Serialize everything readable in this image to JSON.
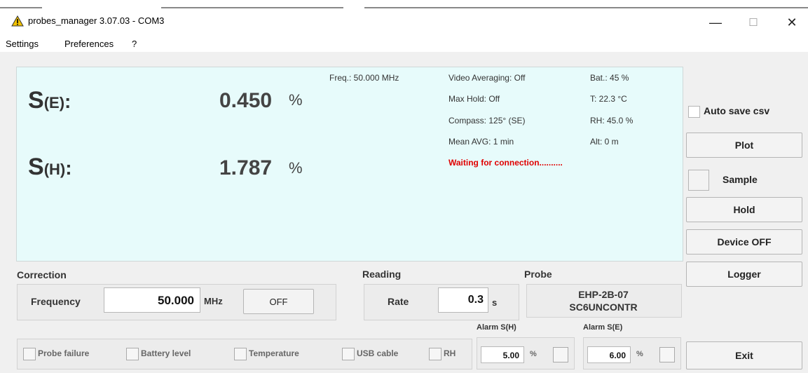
{
  "window": {
    "title": "probes_manager 3.07.03 - COM3",
    "minimize_glyph": "—",
    "maximize_glyph": "☐",
    "close_glyph": "✕"
  },
  "menu": {
    "items": [
      "Settings",
      "Preferences",
      "?"
    ]
  },
  "display": {
    "se_label": "S",
    "se_sub": "(E)",
    "se_colon": ":",
    "se_value": "0.450",
    "se_unit": "%",
    "sh_label": "S",
    "sh_sub": "(H)",
    "sh_colon": ":",
    "sh_value": "1.787",
    "sh_unit": "%",
    "freq": "Freq.: 50.000 MHz",
    "video_avg": "Video Averaging: Off",
    "max_hold": "Max Hold: Off",
    "compass": "Compass: 125° (SE)",
    "mean_avg": "Mean AVG: 1 min",
    "status": "Waiting for connection..........",
    "battery": "Bat.:  45 %",
    "temperature": "T: 22.3 °C",
    "humidity": "RH: 45.0 %",
    "altitude": "Alt: 0 m"
  },
  "side": {
    "auto_save_label": "Auto save csv",
    "plot": "Plot",
    "sample": "Sample",
    "hold": "Hold",
    "device_off": "Device OFF",
    "logger": "Logger",
    "exit": "Exit"
  },
  "correction": {
    "title": "Correction",
    "frequency_label": "Frequency",
    "frequency_value": "50.000",
    "frequency_unit": "MHz",
    "off_button": "OFF"
  },
  "reading": {
    "title": "Reading",
    "rate_label": "Rate",
    "rate_value": "0.3",
    "rate_unit": "s"
  },
  "probe": {
    "title": "Probe",
    "line1": "EHP-2B-07",
    "line2": "SC6UNCONTR"
  },
  "alarms": {
    "sh_title": "Alarm S(H)",
    "sh_value": "5.00",
    "sh_unit": "%",
    "se_title": "Alarm S(E)",
    "se_value": "6.00",
    "se_unit": "%"
  },
  "indicators": [
    "Probe failure",
    "Battery level",
    "Temperature",
    "USB cable",
    "RH"
  ],
  "colors": {
    "display_bg": "#e7fbfb",
    "status_red": "#e00000"
  }
}
